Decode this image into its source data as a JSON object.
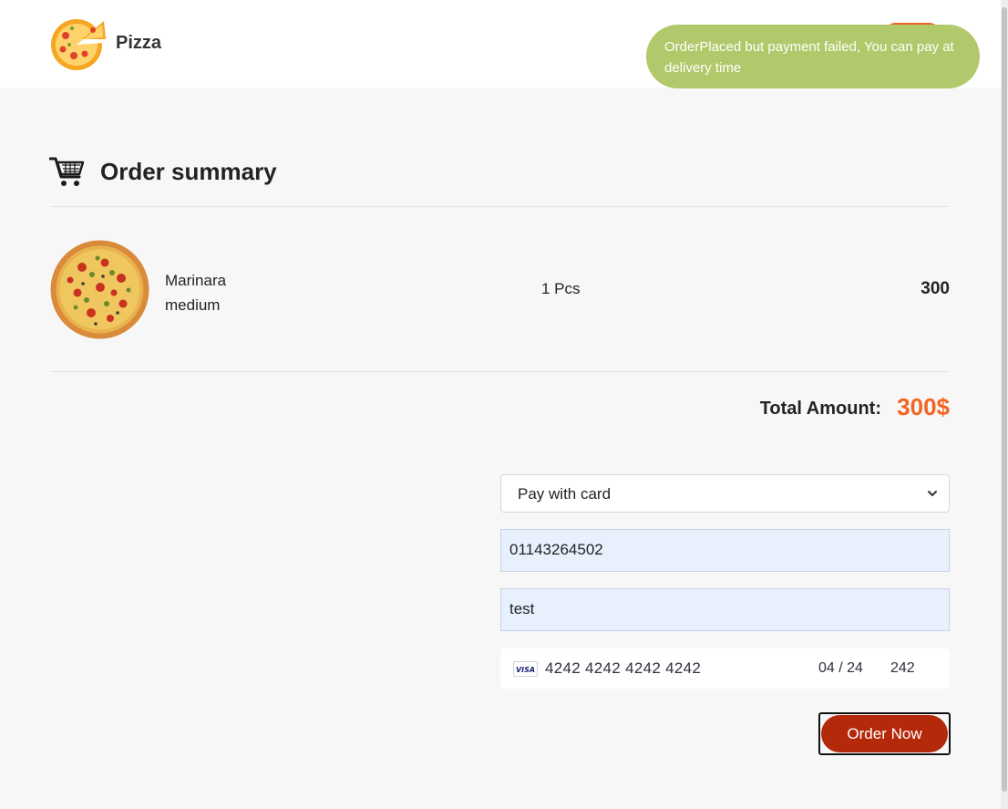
{
  "header": {
    "brand": "Pizza",
    "accent_color": "#f26522"
  },
  "toast": {
    "message": "OrderPlaced but payment failed, You can pay at delivery time",
    "color": "#b1c96a"
  },
  "summary": {
    "title": "Order summary",
    "items": [
      {
        "name": "Marinara",
        "size": "medium",
        "quantity": "1 Pcs",
        "price": "300"
      }
    ],
    "total_label": "Total Amount:",
    "total_value": "300$"
  },
  "payment": {
    "method_selected": "Pay with card",
    "phone_value": "01143264502",
    "address_value": "test",
    "card": {
      "brand_icon": "visa-icon",
      "number": "4242 4242 4242 4242",
      "expiry": "04 / 24",
      "cvc": "242"
    },
    "order_button": "Order Now",
    "order_button_color": "#b5290b"
  }
}
